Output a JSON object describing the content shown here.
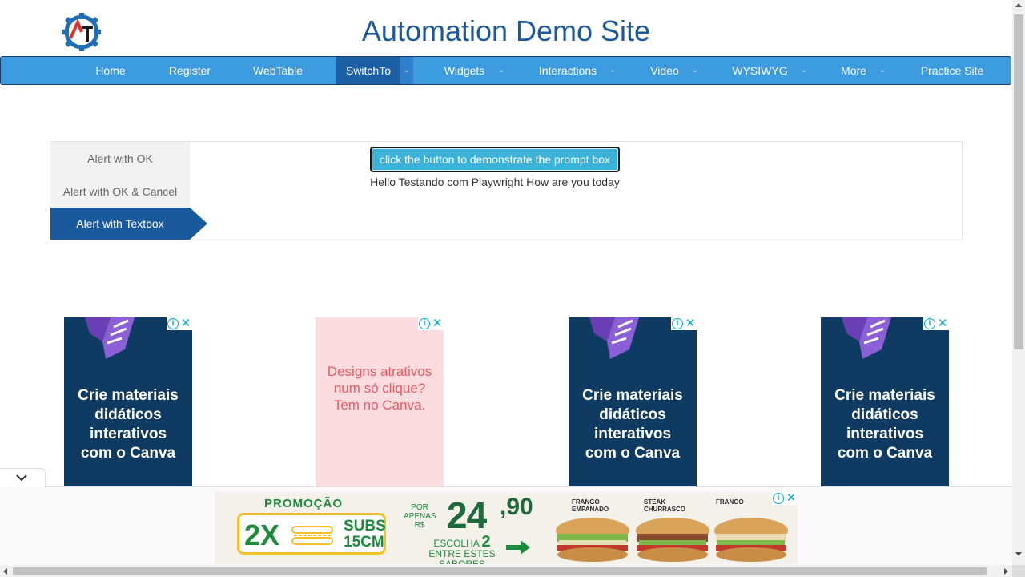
{
  "header": {
    "title": "Automation Demo Site",
    "logo_icon": "gear-at-logo-icon"
  },
  "nav": {
    "items": [
      {
        "label": "Home",
        "dropdown": false
      },
      {
        "label": "Register",
        "dropdown": false
      },
      {
        "label": "WebTable",
        "dropdown": false
      },
      {
        "label": "SwitchTo",
        "dropdown": true,
        "active": true
      },
      {
        "label": "Widgets",
        "dropdown": true
      },
      {
        "label": "Interactions",
        "dropdown": true
      },
      {
        "label": "Video",
        "dropdown": true
      },
      {
        "label": "WYSIWYG",
        "dropdown": true
      },
      {
        "label": "More",
        "dropdown": true
      },
      {
        "label": "Practice Site",
        "dropdown": false
      }
    ]
  },
  "alerts": {
    "tabs": [
      {
        "label": "Alert with OK"
      },
      {
        "label": "Alert with OK & Cancel"
      },
      {
        "label": "Alert with Textbox",
        "active": true
      }
    ],
    "button_label": "click the button to demonstrate the prompt box",
    "result_text": "Hello Testando com Playwright How are you today"
  },
  "ads": [
    {
      "text": "Crie materiais didáticos interativos com o Canva",
      "style": "blue"
    },
    {
      "text": "Designs atrativos num só clique? Tem no Canva.",
      "style": "pink"
    },
    {
      "text": "Crie materiais didáticos interativos com o Canva",
      "style": "blue"
    },
    {
      "text": "Crie materiais didáticos interativos com o Canva",
      "style": "blue"
    }
  ],
  "ad_controls": {
    "info_icon": "i",
    "close_icon": "✕"
  },
  "banner": {
    "promo": "PROMOÇÃO",
    "twox": "2X",
    "subs": "SUBS",
    "size": "15CM",
    "por_apenas": "POR APENAS R$",
    "price": "24",
    "cents": ",90",
    "escolha_pre": "ESCOLHA",
    "escolha_num": "2",
    "escolha_post": "ENTRE ESTES SABORES",
    "flavors": [
      "FRANGO EMPANADO",
      "STEAK CHURRASCO",
      "FRANGO"
    ]
  },
  "colors": {
    "nav_bg": "#3d9be0",
    "nav_active": "#1d5fa5",
    "title": "#1a5a9c",
    "button": "#3bb2d8",
    "ad_blue": "#0f3b63",
    "ad_pink": "#fbdde0",
    "promo_green": "#1e8a3b"
  }
}
